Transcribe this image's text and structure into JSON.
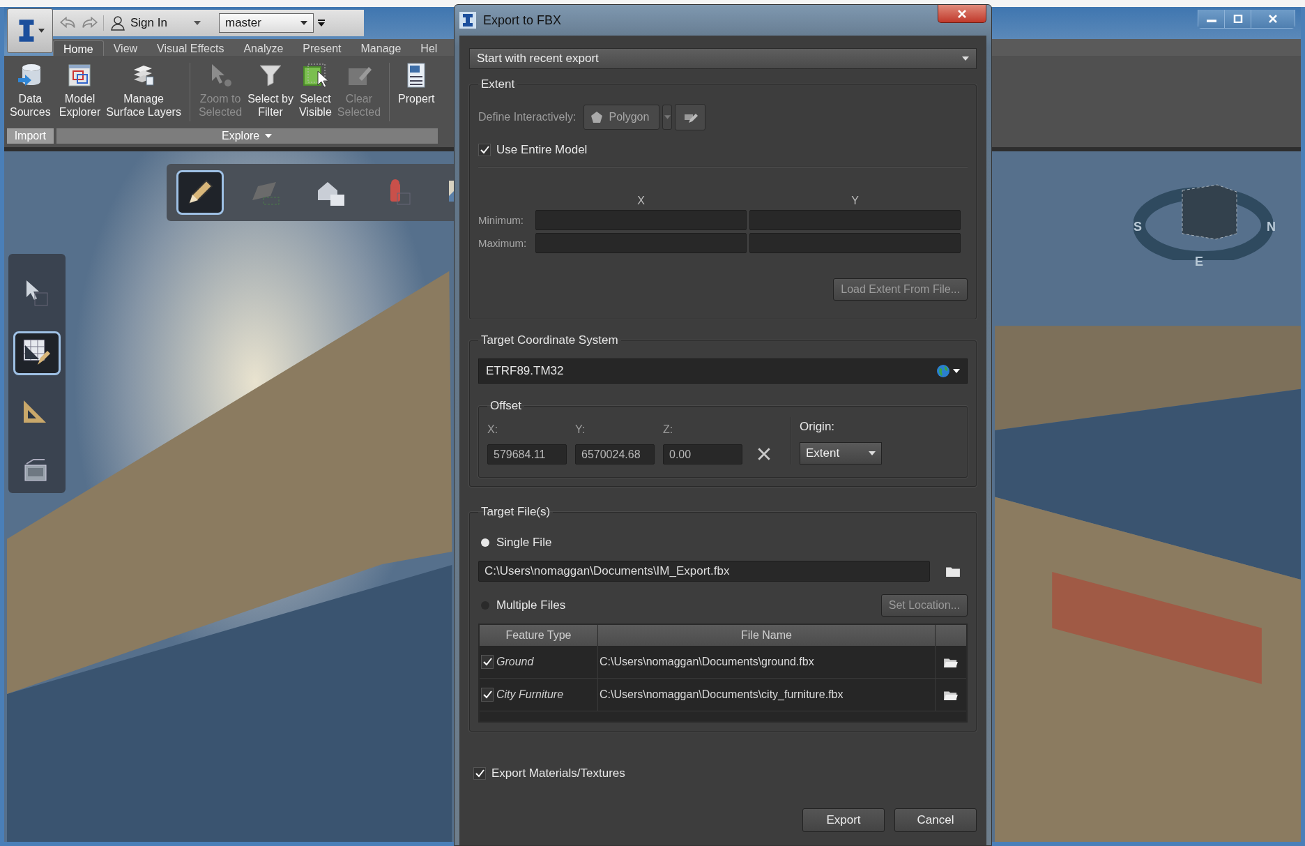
{
  "app": {
    "user": "Sign In",
    "branch": "master",
    "tabs": [
      {
        "label": "Home",
        "selected": true
      },
      {
        "label": "View",
        "selected": false
      },
      {
        "label": "Visual Effects",
        "selected": false
      },
      {
        "label": "Analyze",
        "selected": false
      },
      {
        "label": "Present",
        "selected": false
      },
      {
        "label": "Manage",
        "selected": false
      },
      {
        "label": "Hel",
        "selected": false
      }
    ],
    "ribbon_groups": [
      {
        "label": "Import",
        "panels": [
          [
            {
              "label": "Data\nSources",
              "disabled": false
            }
          ]
        ]
      },
      {
        "label": "Explore",
        "panels": [
          [
            {
              "label": "Model\nExplorer",
              "disabled": false
            },
            {
              "label": "Manage\nSurface Layers",
              "disabled": false
            }
          ],
          [
            {
              "label": "Zoom to\nSelected",
              "disabled": true
            },
            {
              "label": "Select by\nFilter",
              "disabled": false
            },
            {
              "label": "Select\nVisible",
              "disabled": false
            },
            {
              "label": "Clear\nSelected",
              "disabled": true
            }
          ],
          [
            {
              "label": "Propert",
              "disabled": false
            }
          ]
        ]
      }
    ]
  },
  "viewport": {
    "top_tools": [
      {
        "selected": true
      },
      {
        "selected": false
      },
      {
        "selected": false
      },
      {
        "selected": false
      },
      {
        "selected": false
      }
    ],
    "side_tools": [
      {
        "selected": false
      },
      {
        "selected": true
      },
      {
        "selected": false
      },
      {
        "selected": false
      }
    ],
    "compass": [
      "S",
      "N",
      "E"
    ]
  },
  "dialog": {
    "title": "Export to FBX",
    "preset": "Start with recent export",
    "extent": {
      "legend": "Extent",
      "disabled": true,
      "define_label": "Define Interactively:",
      "shape_button": "Polygon",
      "use_entire_model": {
        "label": "Use Entire Model",
        "checked": true
      },
      "columns": [
        "X",
        "Y"
      ],
      "rows": [
        "Minimum:",
        "Maximum:"
      ],
      "load_button": "Load Extent From File..."
    },
    "coordinate_system": {
      "legend": "Target Coordinate System",
      "value": "ETRF89.TM32",
      "offset": {
        "legend": "Offset",
        "fields": [
          {
            "label": "X:",
            "value": "579684.11"
          },
          {
            "label": "Y:",
            "value": "6570024.68"
          },
          {
            "label": "Z:",
            "value": "0.00"
          }
        ],
        "origin_label": "Origin:",
        "origin": "Extent"
      }
    },
    "target_files": {
      "legend": "Target File(s)",
      "options": [
        {
          "label": "Single File",
          "selected": true
        },
        {
          "label": "Multiple Files",
          "selected": false
        }
      ],
      "single_path": "C:\\Users\\nomaggan\\Documents\\IM_Export.fbx",
      "set_location": {
        "label": "Set Location...",
        "disabled": true
      },
      "columns": [
        "Feature Type",
        "File Name"
      ],
      "rows": [
        {
          "checked": true,
          "feature": "Ground",
          "file": "C:\\Users\\nomaggan\\Documents\\ground.fbx"
        },
        {
          "checked": true,
          "feature": "City Furniture",
          "file": "C:\\Users\\nomaggan\\Documents\\city_furniture.fbx"
        }
      ]
    },
    "export_materials": {
      "label": "Export Materials/Textures",
      "checked": true
    },
    "buttons": [
      "Export",
      "Cancel"
    ]
  }
}
